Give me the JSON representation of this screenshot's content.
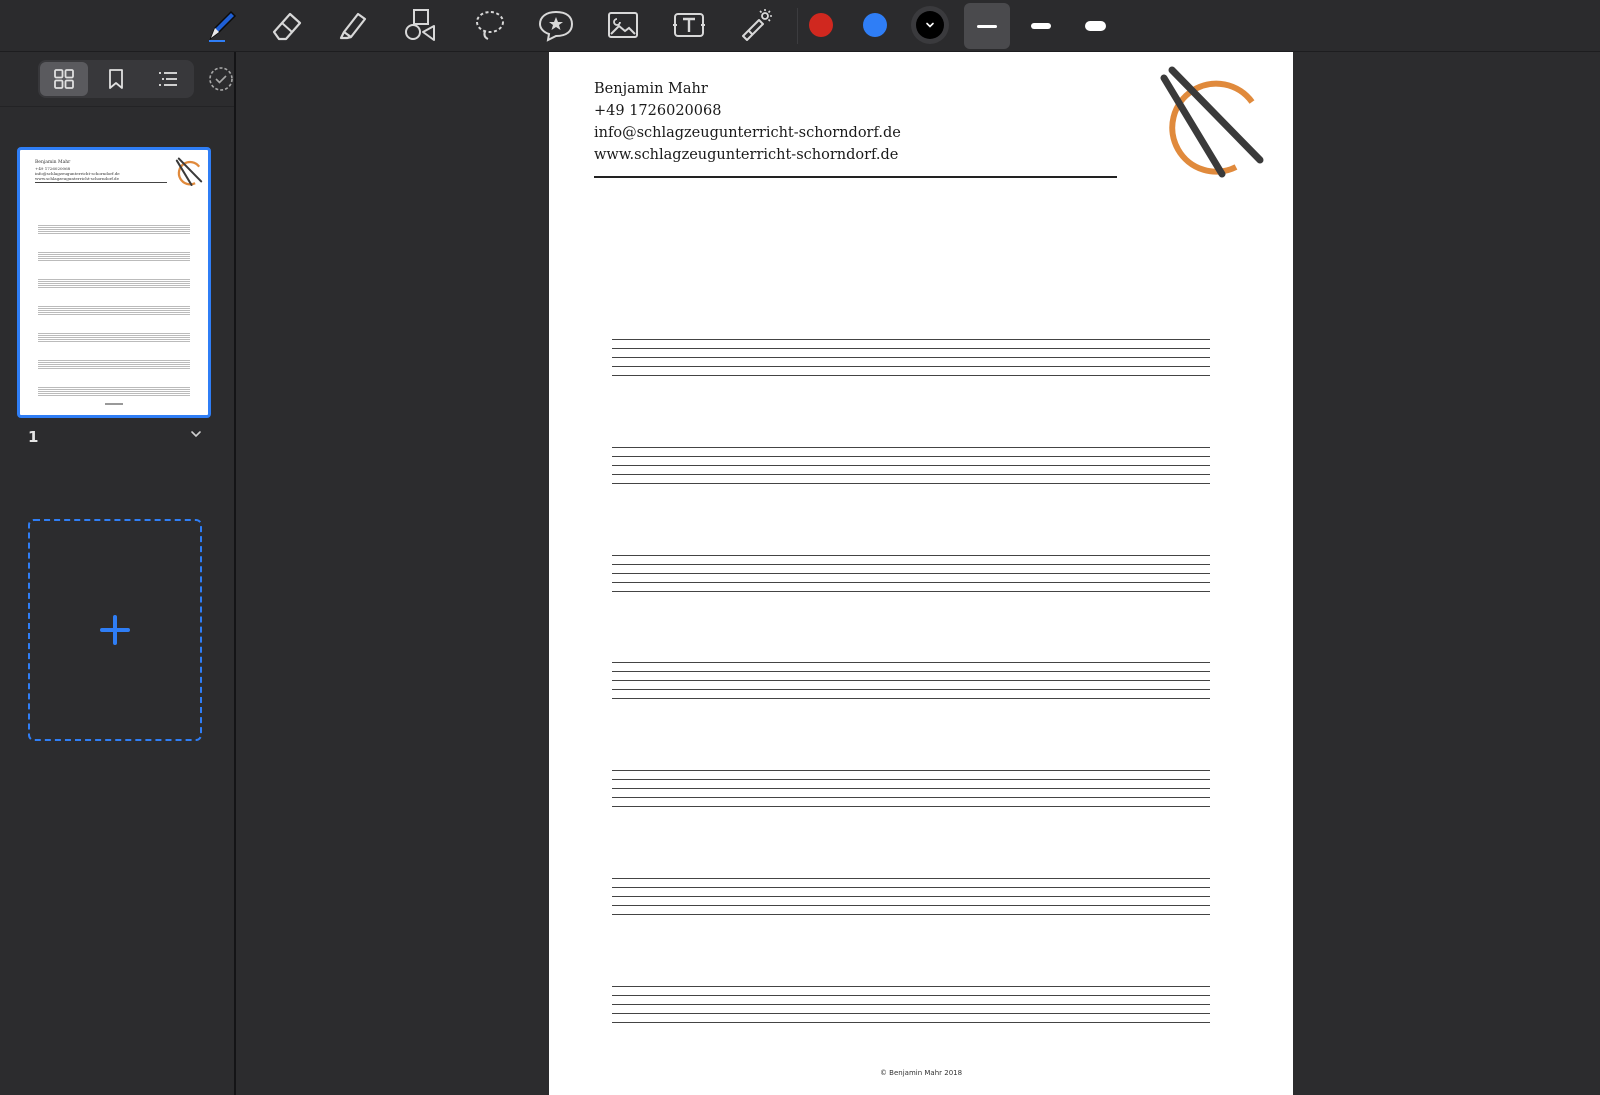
{
  "toolbar": {
    "tools": [
      "pen-icon",
      "eraser-icon",
      "highlighter-icon",
      "shapes-icon",
      "lasso-icon",
      "sticker-icon",
      "image-icon",
      "text-box-icon",
      "laser-pointer-icon"
    ],
    "colors": {
      "red": "#d0281f",
      "blue": "#2f7ef6",
      "black": "#000000",
      "accent": "#2f7ef6"
    },
    "selected_tool": "pen",
    "selected_width": "thin"
  },
  "sidebar": {
    "views": [
      "thumbnails-grid-icon",
      "bookmark-icon",
      "outline-list-icon"
    ],
    "active_view": "thumbnails",
    "pages": [
      {
        "number": "1"
      }
    ],
    "add_page": "+"
  },
  "document": {
    "contact": {
      "name": "Benjamin Mahr",
      "phone": "+49 1726020068",
      "email": "info@schlagzeugunterricht-schorndorf.de",
      "website": "www.schlagzeugunterricht-schorndorf.de"
    },
    "staff_count": 7,
    "footer": "© Benjamin Mahr 2018"
  }
}
